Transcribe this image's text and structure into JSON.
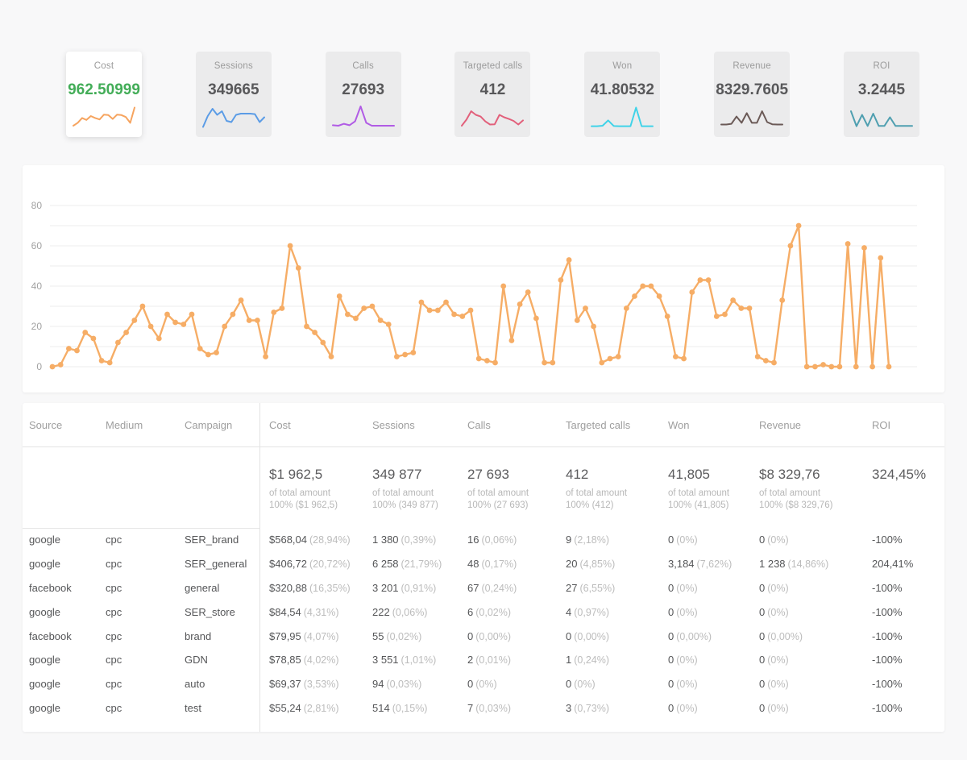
{
  "kpi_cards": [
    {
      "label": "Cost",
      "value": "962.50999",
      "value_color": "#43ad58",
      "line_color": "#f6a45f",
      "selected": true,
      "spark": [
        1,
        2.2,
        4.2,
        3.4,
        5,
        4.2,
        3.6,
        5.6,
        5.4,
        3.8,
        5.6,
        5.4,
        4.6,
        2.2,
        8.5
      ]
    },
    {
      "label": "Sessions",
      "value": "349665",
      "value_color": "#58585a",
      "line_color": "#5b9ce6",
      "selected": false,
      "spark": [
        0.5,
        5,
        8,
        5.5,
        7,
        3,
        2.5,
        5.5,
        6,
        6,
        6,
        5.8,
        2.5,
        4.5
      ]
    },
    {
      "label": "Calls",
      "value": "27693",
      "value_color": "#58585a",
      "line_color": "#b15ce5",
      "selected": false,
      "spark": [
        1.2,
        1,
        1.8,
        1.2,
        2.8,
        9,
        2.2,
        1,
        1,
        1,
        1,
        1
      ]
    },
    {
      "label": "Targeted calls",
      "value": "412",
      "value_color": "#58585a",
      "line_color": "#e2607b",
      "selected": false,
      "spark": [
        1,
        3.5,
        7,
        5.5,
        4.8,
        2.8,
        1.5,
        1.6,
        5.5,
        4.5,
        3.8,
        3,
        1.5,
        3.2
      ]
    },
    {
      "label": "Won",
      "value": "41.80532",
      "value_color": "#58585a",
      "line_color": "#40d3e8",
      "selected": false,
      "spark": [
        0.8,
        0.8,
        1,
        3.2,
        0.9,
        0.8,
        0.8,
        0.8,
        8.5,
        0.8,
        0.8,
        0.8
      ]
    },
    {
      "label": "Revenue",
      "value": "8329.7605",
      "value_color": "#58585a",
      "line_color": "#6b5a57",
      "selected": false,
      "spark": [
        1.5,
        1.5,
        1.8,
        4.8,
        2.2,
        6.2,
        2.2,
        2.2,
        7,
        2.5,
        1.6,
        1.5,
        1.5
      ]
    },
    {
      "label": "ROI",
      "value": "3.2445",
      "value_color": "#58585a",
      "line_color": "#4f9fb0",
      "selected": false,
      "spark": [
        7,
        0.8,
        5.5,
        0.9,
        6,
        0.9,
        0.9,
        4.5,
        0.9,
        0.9,
        0.9,
        0.9
      ]
    }
  ],
  "chart_data": {
    "type": "line",
    "title": "",
    "xlabel": "",
    "ylabel": "",
    "ylim": [
      0,
      80
    ],
    "yticks": [
      0,
      20,
      40,
      60,
      80
    ],
    "grid_step": 10,
    "grid": true,
    "legend_position": "none",
    "color": "#f6ad66",
    "markers": true,
    "series": [
      {
        "name": "Cost",
        "values": [
          0,
          1,
          9,
          8,
          17,
          14,
          3,
          2,
          12,
          17,
          23,
          30,
          20,
          14,
          26,
          22,
          21,
          26,
          9,
          6,
          7,
          20,
          26,
          33,
          23,
          23,
          5,
          27,
          29,
          60,
          49,
          20,
          17,
          12,
          5,
          35,
          26,
          24,
          29,
          30,
          23,
          21,
          5,
          6,
          7,
          32,
          28,
          28,
          32,
          26,
          25,
          28,
          4,
          3,
          2,
          40,
          13,
          31,
          37,
          24,
          2,
          2,
          43,
          53,
          23,
          29,
          20,
          2,
          4,
          5,
          29,
          35,
          40,
          40,
          35,
          25,
          5,
          4,
          37,
          43,
          43,
          25,
          26,
          33,
          29,
          29,
          5,
          3,
          2,
          33,
          60,
          70,
          0,
          0,
          1,
          0,
          0,
          61,
          0,
          59,
          0,
          54,
          0
        ]
      }
    ]
  },
  "table": {
    "columns": [
      "Source",
      "Medium",
      "Campaign",
      "Cost",
      "Sessions",
      "Calls",
      "Targeted calls",
      "Won",
      "Revenue",
      "ROI"
    ],
    "summary": {
      "cost": {
        "value": "$1 962,5",
        "sub1": "of total amount",
        "sub2": "100% ($1 962,5)"
      },
      "sessions": {
        "value": "349 877",
        "sub1": "of total amount",
        "sub2": "100% (349 877)"
      },
      "calls": {
        "value": "27 693",
        "sub1": "of total amount",
        "sub2": "100% (27 693)"
      },
      "targeted": {
        "value": "412",
        "sub1": "of total amount",
        "sub2": "100% (412)"
      },
      "won": {
        "value": "41,805",
        "sub1": "of total amount",
        "sub2": "100% (41,805)"
      },
      "revenue": {
        "value": "$8 329,76",
        "sub1": "of total amount",
        "sub2": "100% ($8 329,76)"
      },
      "roi": {
        "value": "324,45%",
        "sub1": "",
        "sub2": ""
      }
    },
    "rows": [
      {
        "source": "google",
        "medium": "cpc",
        "campaign": "SER_brand",
        "cost": "$568,04",
        "cost_pct": "(28,94%)",
        "sessions": "1 380",
        "sessions_pct": "(0,39%)",
        "calls": "16",
        "calls_pct": "(0,06%)",
        "targeted": "9",
        "targeted_pct": "(2,18%)",
        "won": "0",
        "won_pct": "(0%)",
        "revenue": "0",
        "revenue_pct": "(0%)",
        "roi": "-100%"
      },
      {
        "source": "google",
        "medium": "cpc",
        "campaign": "SER_general",
        "cost": "$406,72",
        "cost_pct": "(20,72%)",
        "sessions": "6 258",
        "sessions_pct": "(21,79%)",
        "calls": "48",
        "calls_pct": "(0,17%)",
        "targeted": "20",
        "targeted_pct": "(4,85%)",
        "won": "3,184",
        "won_pct": "(7,62%)",
        "revenue": "1 238",
        "revenue_pct": "(14,86%)",
        "roi": "204,41%"
      },
      {
        "source": "facebook",
        "medium": "cpc",
        "campaign": "general",
        "cost": "$320,88",
        "cost_pct": "(16,35%)",
        "sessions": "3 201",
        "sessions_pct": "(0,91%)",
        "calls": "67",
        "calls_pct": "(0,24%)",
        "targeted": "27",
        "targeted_pct": "(6,55%)",
        "won": "0",
        "won_pct": "(0%)",
        "revenue": "0",
        "revenue_pct": "(0%)",
        "roi": "-100%"
      },
      {
        "source": "google",
        "medium": "cpc",
        "campaign": "SER_store",
        "cost": "$84,54",
        "cost_pct": "(4,31%)",
        "sessions": "222",
        "sessions_pct": "(0,06%)",
        "calls": "6",
        "calls_pct": "(0,02%)",
        "targeted": "4",
        "targeted_pct": "(0,97%)",
        "won": "0",
        "won_pct": "(0%)",
        "revenue": "0",
        "revenue_pct": "(0%)",
        "roi": "-100%"
      },
      {
        "source": "facebook",
        "medium": "cpc",
        "campaign": "brand",
        "cost": "$79,95",
        "cost_pct": "(4,07%)",
        "sessions": "55",
        "sessions_pct": "(0,02%)",
        "calls": "0",
        "calls_pct": "(0,00%)",
        "targeted": "0",
        "targeted_pct": "(0,00%)",
        "won": "0",
        "won_pct": "(0,00%)",
        "revenue": "0",
        "revenue_pct": "(0,00%)",
        "roi": "-100%"
      },
      {
        "source": "google",
        "medium": "cpc",
        "campaign": "GDN",
        "cost": "$78,85",
        "cost_pct": "(4,02%)",
        "sessions": "3 551",
        "sessions_pct": "(1,01%)",
        "calls": "2",
        "calls_pct": "(0,01%)",
        "targeted": "1",
        "targeted_pct": "(0,24%)",
        "won": "0",
        "won_pct": "(0%)",
        "revenue": "0",
        "revenue_pct": "(0%)",
        "roi": "-100%"
      },
      {
        "source": "google",
        "medium": "cpc",
        "campaign": "auto",
        "cost": "$69,37",
        "cost_pct": "(3,53%)",
        "sessions": "94",
        "sessions_pct": "(0,03%)",
        "calls": "0",
        "calls_pct": "(0%)",
        "targeted": "0",
        "targeted_pct": "(0%)",
        "won": "0",
        "won_pct": "(0%)",
        "revenue": "0",
        "revenue_pct": "(0%)",
        "roi": "-100%"
      },
      {
        "source": "google",
        "medium": "cpc",
        "campaign": "test",
        "cost": "$55,24",
        "cost_pct": "(2,81%)",
        "sessions": "514",
        "sessions_pct": "(0,15%)",
        "calls": "7",
        "calls_pct": "(0,03%)",
        "targeted": "3",
        "targeted_pct": "(0,73%)",
        "won": "0",
        "won_pct": "(0%)",
        "revenue": "0",
        "revenue_pct": "(0%)",
        "roi": "-100%"
      }
    ]
  }
}
